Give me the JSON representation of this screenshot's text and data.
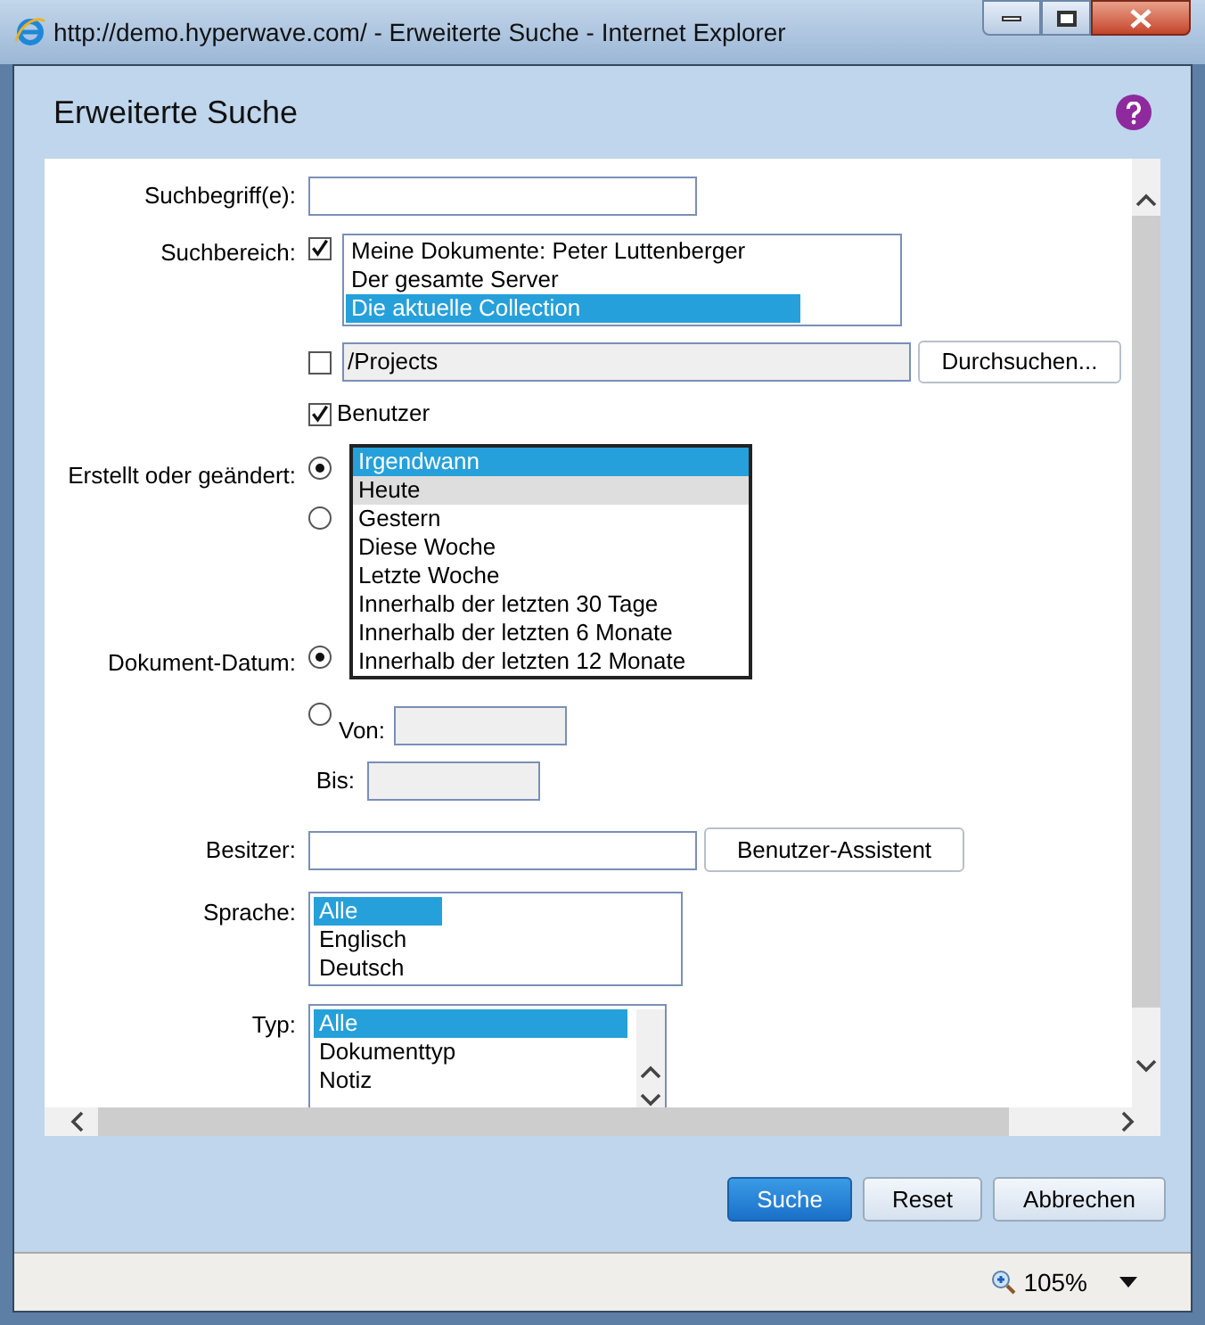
{
  "window": {
    "title": "http://demo.hyperwave.com/ - Erweiterte Suche - Internet Explorer"
  },
  "dialog": {
    "title": "Erweiterte Suche"
  },
  "search_terms": {
    "label": "Suchbegriff(e):"
  },
  "scope": {
    "label": "Suchbereich:",
    "checked": true,
    "options": [
      {
        "label": "Meine Dokumente: Peter Luttenberger",
        "selected": false
      },
      {
        "label": "Der gesamte Server",
        "selected": false
      },
      {
        "label": "Die aktuelle Collection",
        "selected": true
      }
    ]
  },
  "path": {
    "checked": false,
    "value": "/Projects",
    "button": "Durchsuchen..."
  },
  "user": {
    "label": "Benutzer",
    "checked": true
  },
  "modified": {
    "label": "Erstellt oder geändert:",
    "radios": [
      {
        "selected": true
      },
      {
        "selected": false
      }
    ],
    "dropdown": [
      {
        "label": "Irgendwann",
        "selected": true,
        "hovered": false
      },
      {
        "label": "Heute",
        "selected": false,
        "hovered": true
      },
      {
        "label": "Gestern",
        "selected": false,
        "hovered": false
      },
      {
        "label": "Diese Woche",
        "selected": false,
        "hovered": false
      },
      {
        "label": "Letzte Woche",
        "selected": false,
        "hovered": false
      },
      {
        "label": "Innerhalb der letzten 30 Tage",
        "selected": false,
        "hovered": false
      },
      {
        "label": "Innerhalb der letzten 6 Monate",
        "selected": false,
        "hovered": false
      },
      {
        "label": "Innerhalb der letzten 12 Monate",
        "selected": false,
        "hovered": false
      }
    ]
  },
  "document_date": {
    "label": "Dokument-Datum:",
    "radios": [
      {
        "selected": true
      },
      {
        "selected": false
      }
    ],
    "from_label": "Von:",
    "to_label": "Bis:"
  },
  "owner": {
    "label": "Besitzer:",
    "button": "Benutzer-Assistent"
  },
  "language": {
    "label": "Sprache:",
    "options": [
      {
        "label": "Alle",
        "selected": true
      },
      {
        "label": "Englisch",
        "selected": false
      },
      {
        "label": "Deutsch",
        "selected": false
      }
    ]
  },
  "type": {
    "label": "Typ:",
    "options": [
      {
        "label": "Alle",
        "selected": true
      },
      {
        "label": "Dokumenttyp",
        "selected": false
      },
      {
        "label": "Notiz",
        "selected": false
      }
    ]
  },
  "buttons": [
    {
      "label": "Suche",
      "kind": "primary"
    },
    {
      "label": "Reset",
      "kind": "secondary"
    },
    {
      "label": "Abbrechen",
      "kind": "secondary"
    }
  ],
  "status_bar": {
    "zoom": "105%"
  }
}
